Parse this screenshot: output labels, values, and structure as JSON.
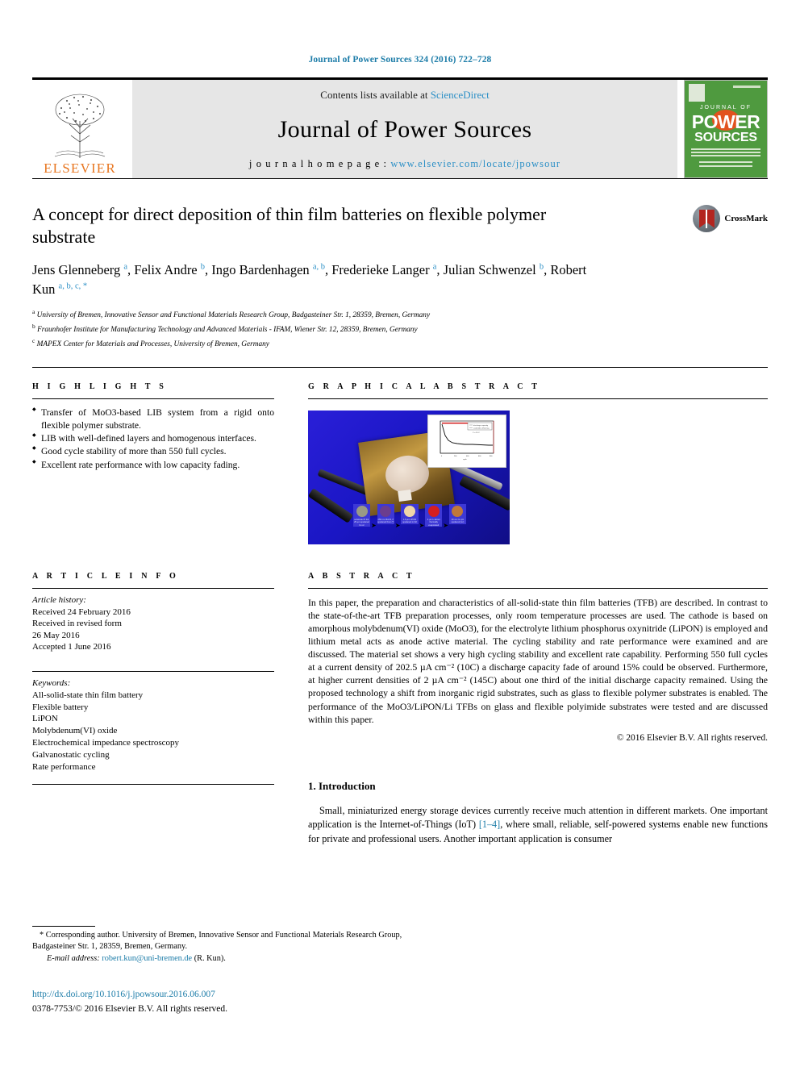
{
  "running_head": "Journal of Power Sources 324 (2016) 722–728",
  "masthead": {
    "contents_prefix": "Contents lists available at ",
    "sciencedirect": "ScienceDirect",
    "journal_name": "Journal of Power Sources",
    "homepage_prefix": "j o u r n a l   h o m e p a g e :  ",
    "homepage_url": "www.elsevier.com/locate/jpowsour",
    "publisher": "ELSEVIER",
    "cover": {
      "journal_of": "JOURNAL OF",
      "power": "POWER",
      "sources": "SOURCES"
    }
  },
  "article": {
    "title": "A concept for direct deposition of thin film batteries on flexible polymer substrate",
    "authors_line1": "Jens Glenneberg ",
    "authors": [
      {
        "name": "Jens Glenneberg",
        "sup": "a"
      },
      {
        "name": "Felix Andre",
        "sup": "b"
      },
      {
        "name": "Ingo Bardenhagen",
        "sup": "a, b"
      },
      {
        "name": "Frederieke Langer",
        "sup": "a"
      },
      {
        "name": "Julian Schwenzel",
        "sup": "b"
      },
      {
        "name": "Robert Kun",
        "sup": "a, b, c, *"
      }
    ],
    "affiliations": [
      {
        "mark": "a",
        "text": "University of Bremen, Innovative Sensor and Functional Materials Research Group, Badgasteiner Str. 1, 28359, Bremen, Germany"
      },
      {
        "mark": "b",
        "text": "Fraunhofer Institute for Manufacturing Technology and Advanced Materials - IFAM, Wiener Str. 12, 28359, Bremen, Germany"
      },
      {
        "mark": "c",
        "text": "MAPEX Center for Materials and Processes, University of Bremen, Germany"
      }
    ],
    "crossmark_label": "CrossMark"
  },
  "highlights": {
    "heading": "H I G H L I G H T S",
    "items": [
      "Transfer of MoO3-based LIB system from a rigid onto flexible polymer substrate.",
      "LIB with well-defined layers and homogenous interfaces.",
      "Good cycle stability of more than 550 full cycles.",
      "Excellent rate performance with low capacity fading."
    ]
  },
  "graphical_abstract": {
    "heading": "G R A P H I C A L   A B S T R A C T",
    "inset_legend": [
      "discharge capacity",
      "coulombic efficiency"
    ],
    "inset_annotation": "C = 10 C⁻¹",
    "process_steps": [
      {
        "color": "#9a9a86",
        "caption": "substrate PI foil, 25 µm sputtered Cu cc"
      },
      {
        "color": "#6b3d8f",
        "caption": "250 nm MoO3, rf sputtered from (°)"
      },
      {
        "color": "#efd6a8",
        "caption": "1.6 µm LiPON sputtered in N2"
      },
      {
        "color": "#d61f1f",
        "caption": "4 µm Li about thermally evaporated"
      },
      {
        "color": "#c0783a",
        "caption": "40 nm Cu pin sputtered (cc)"
      }
    ]
  },
  "article_info": {
    "heading": "A R T I C L E   I N F O",
    "history_label": "Article history:",
    "history": [
      "Received 24 February 2016",
      "Received in revised form",
      "26 May 2016",
      "Accepted 1 June 2016"
    ],
    "keywords_label": "Keywords:",
    "keywords": [
      "All-solid-state thin film battery",
      "Flexible battery",
      "LiPON",
      "Molybdenum(VI) oxide",
      "Electrochemical impedance spectroscopy",
      "Galvanostatic cycling",
      "Rate performance"
    ]
  },
  "abstract": {
    "heading": "A B S T R A C T",
    "body": "In this paper, the preparation and characteristics of all-solid-state thin film batteries (TFB) are described. In contrast to the state-of-the-art TFB preparation processes, only room temperature processes are used. The cathode is based on amorphous molybdenum(VI) oxide (MoO3), for the electrolyte lithium phosphorus oxynitride (LiPON) is employed and lithium metal acts as anode active material. The cycling stability and rate performance were examined and are discussed. The material set shows a very high cycling stability and excellent rate capability. Performing 550 full cycles at a current density of 202.5 µA cm⁻² (10C) a discharge capacity fade of around 15% could be observed. Furthermore, at higher current densities of 2 µA cm⁻² (145C) about one third of the initial discharge capacity remained. Using the proposed technology a shift from inorganic rigid substrates, such as glass to flexible polymer substrates is enabled. The performance of the MoO3/LiPON/Li TFBs on glass and flexible polyimide substrates were tested and are discussed within this paper.",
    "copyright": "© 2016 Elsevier B.V. All rights reserved."
  },
  "introduction": {
    "heading": "1. Introduction",
    "paragraph_pre": "Small, miniaturized energy storage devices currently receive much attention in different markets. One important application is the Internet-of-Things (IoT) ",
    "reference": "[1–4]",
    "paragraph_post": ", where small, reliable, self-powered systems enable new functions for private and professional users. Another important application is consumer"
  },
  "footer": {
    "corresponding_marker": "*",
    "corresponding": "Corresponding author. University of Bremen, Innovative Sensor and Functional Materials Research Group, Badgasteiner Str. 1, 28359, Bremen, Germany.",
    "email_label": "E-mail address:",
    "email": "robert.kun@uni-bremen.de",
    "email_attrib": "(R. Kun).",
    "doi": "http://dx.doi.org/10.1016/j.jpowsour.2016.06.007",
    "issn": "0378-7753/© 2016 Elsevier B.V. All rights reserved."
  },
  "colors": {
    "link": "#1c7ca8",
    "sciencedirect": "#2b8fc6",
    "elsevier_orange": "#e87722",
    "superscript": "#2b8fc6"
  }
}
